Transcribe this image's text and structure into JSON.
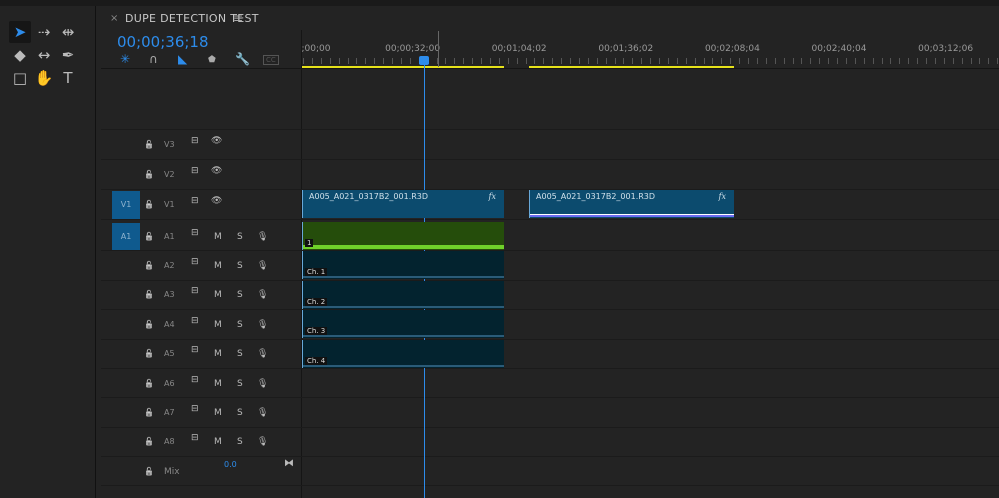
{
  "sequence": {
    "title": "DUPE DETECTION TEST",
    "timecode": "00;00;36;18",
    "close_icon": "×",
    "menu_icon": "≡"
  },
  "tools": [
    {
      "name": "selection",
      "glyph": "➤"
    },
    {
      "name": "track-select",
      "glyph": "⇢"
    },
    {
      "name": "ripple-edit",
      "glyph": "⇹"
    },
    {
      "name": "razor",
      "glyph": "◆"
    },
    {
      "name": "slip",
      "glyph": "↔"
    },
    {
      "name": "pen",
      "glyph": "✒"
    },
    {
      "name": "rectangle",
      "glyph": "□"
    },
    {
      "name": "hand",
      "glyph": "✋"
    },
    {
      "name": "type",
      "glyph": "T"
    }
  ],
  "timeline_tools": {
    "snap": "✳",
    "link": "∩",
    "insert": "◣",
    "marker": "⬟",
    "settings": "🔧",
    "captions": "CC"
  },
  "ruler": {
    "labels": [
      ";00;00",
      "00;00;32;00",
      "00;01;04;02",
      "00;01;36;02",
      "00;02;08;04",
      "00;02;40;04",
      "00;03;12;06"
    ]
  },
  "video_tracks": [
    {
      "name": "V3"
    },
    {
      "name": "V2"
    },
    {
      "name": "V1",
      "target": "V1"
    }
  ],
  "audio_tracks": [
    {
      "name": "A1",
      "target": "A1"
    },
    {
      "name": "A2"
    },
    {
      "name": "A3"
    },
    {
      "name": "A4"
    },
    {
      "name": "A5"
    },
    {
      "name": "A6"
    },
    {
      "name": "A7"
    },
    {
      "name": "A8"
    }
  ],
  "track_labels": {
    "mute": "M",
    "solo": "S",
    "lock": "🔓",
    "eye": "👁",
    "mic": "🎙",
    "sync": "⊟"
  },
  "mix": {
    "label": "Mix",
    "value": "0.0",
    "icon": "⧓"
  },
  "clips": {
    "video": [
      {
        "name": "A005_A021_0317B2_001.R3D",
        "fx": "fx"
      },
      {
        "name": "A005_A021_0317B2_001.R3D",
        "fx": "fx"
      }
    ],
    "audio": [
      {
        "label": "1"
      },
      {
        "label": "Ch. 1"
      },
      {
        "label": "Ch. 2"
      },
      {
        "label": "Ch. 3"
      },
      {
        "label": "Ch. 4"
      }
    ]
  }
}
